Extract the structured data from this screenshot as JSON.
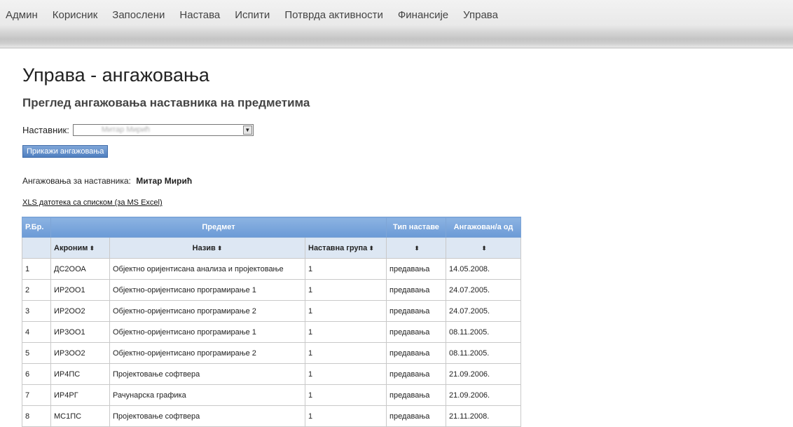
{
  "nav": [
    "Админ",
    "Корисник",
    "Запослени",
    "Настава",
    "Испити",
    "Потврда активности",
    "Финансије",
    "Управа"
  ],
  "page_title": "Управа - ангажовања",
  "subtitle": "Преглед ангажовања наставника на предметима",
  "form": {
    "teacher_label": "Наставник:",
    "teacher_value": "Митар Мирић",
    "show_button": "Прикажи ангажовања"
  },
  "engaged": {
    "label": "Ангажовања за наставника:",
    "name": "Митар Мирић"
  },
  "xls_link": "XLS датотека са списком (за MS Excel)",
  "table": {
    "group_headers": {
      "rbr": "Р.Бр.",
      "predmet": "Предмет",
      "tip": "Тип наставе",
      "od": "Ангажован/а од"
    },
    "sub_headers": {
      "akronim": "Акроним",
      "naziv": "Назив",
      "grupa": "Наставна група",
      "sort_symbol": "⬍"
    },
    "rows": [
      {
        "rbr": "1",
        "akronim": "ДС2ООА",
        "naziv": "Објектно оријентисана анализа и пројектовање",
        "grupa": "1",
        "tip": "предавања",
        "od": "14.05.2008."
      },
      {
        "rbr": "2",
        "akronim": "ИР2ОО1",
        "naziv": "Објектно-оријентисано програмирање 1",
        "grupa": "1",
        "tip": "предавања",
        "od": "24.07.2005."
      },
      {
        "rbr": "3",
        "akronim": "ИР2ОО2",
        "naziv": "Објектно-оријентисано програмирање 2",
        "grupa": "1",
        "tip": "предавања",
        "od": "24.07.2005."
      },
      {
        "rbr": "4",
        "akronim": "ИР3ОО1",
        "naziv": "Објектно-оријентисано програмирање 1",
        "grupa": "1",
        "tip": "предавања",
        "od": "08.11.2005."
      },
      {
        "rbr": "5",
        "akronim": "ИР3ОО2",
        "naziv": "Објектно-оријентисано програмирање 2",
        "grupa": "1",
        "tip": "предавања",
        "od": "08.11.2005."
      },
      {
        "rbr": "6",
        "akronim": "ИР4ПС",
        "naziv": "Пројектовање софтвера",
        "grupa": "1",
        "tip": "предавања",
        "od": "21.09.2006."
      },
      {
        "rbr": "7",
        "akronim": "ИР4РГ",
        "naziv": "Рачунарска графика",
        "grupa": "1",
        "tip": "предавања",
        "od": "21.09.2006."
      },
      {
        "rbr": "8",
        "akronim": "МС1ПС",
        "naziv": "Пројектовање софтвера",
        "grupa": "1",
        "tip": "предавања",
        "od": "21.11.2008."
      }
    ]
  }
}
